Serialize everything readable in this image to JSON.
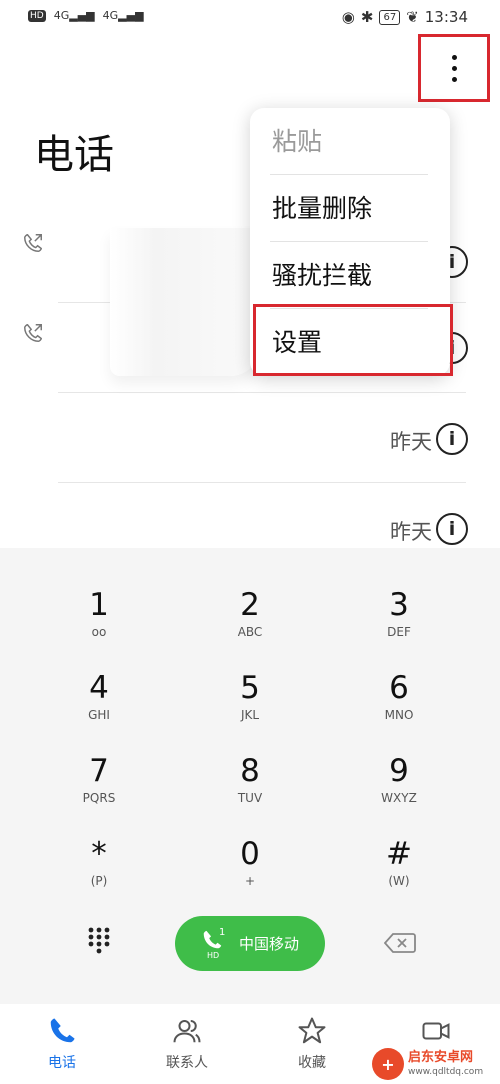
{
  "status_bar": {
    "left_badge": "HD",
    "signal_1": "4G",
    "signal_2": "4G",
    "battery": "67",
    "time": "13:34"
  },
  "header": {
    "title": "电话"
  },
  "menu": {
    "items": [
      {
        "label": "粘贴",
        "enabled": false
      },
      {
        "label": "批量删除",
        "enabled": true
      },
      {
        "label": "骚扰拦截",
        "enabled": true
      },
      {
        "label": "设置",
        "enabled": true
      }
    ]
  },
  "calls": [
    {
      "when": ""
    },
    {
      "when": ""
    },
    {
      "when": "昨天"
    },
    {
      "when": "昨天"
    }
  ],
  "dialpad": {
    "keys": [
      {
        "digit": "1",
        "letters": "voicemail-icon"
      },
      {
        "digit": "2",
        "letters": "ABC"
      },
      {
        "digit": "3",
        "letters": "DEF"
      },
      {
        "digit": "4",
        "letters": "GHI"
      },
      {
        "digit": "5",
        "letters": "JKL"
      },
      {
        "digit": "6",
        "letters": "MNO"
      },
      {
        "digit": "7",
        "letters": "PQRS"
      },
      {
        "digit": "8",
        "letters": "TUV"
      },
      {
        "digit": "9",
        "letters": "WXYZ"
      },
      {
        "digit": "*",
        "letters": "(P)"
      },
      {
        "digit": "0",
        "letters": "+"
      },
      {
        "digit": "#",
        "letters": "(W)"
      }
    ],
    "call_button_label": "中国移动",
    "call_sim_index": "1",
    "call_hd": "HD"
  },
  "tabs": [
    {
      "label": "电话",
      "active": true
    },
    {
      "label": "联系人",
      "active": false
    },
    {
      "label": "收藏",
      "active": false
    }
  ],
  "watermark": {
    "logo": "+",
    "title": "启东安卓网",
    "url": "www.qdltdq.com"
  },
  "colors": {
    "accent": "#1a73e8",
    "call_green": "#3fbd49",
    "highlight_red": "#d8282f"
  }
}
